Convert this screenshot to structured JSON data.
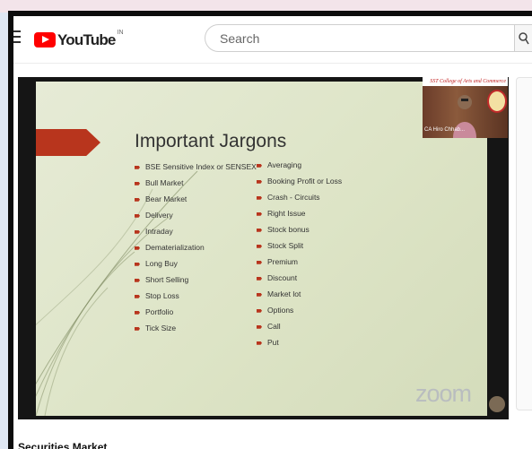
{
  "header": {
    "logo_text": "YouTube",
    "region": "IN",
    "search_placeholder": "Search",
    "search_icon": "search-icon",
    "menu_icon": "hamburger-menu-icon"
  },
  "slide": {
    "title": "Important Jargons",
    "left_items": [
      "BSE Sensitive Index or SENSEX",
      "Bull Market",
      "Bear Market",
      "Delivery",
      "Intraday",
      "Dematerialization",
      "Long Buy",
      "Short Selling",
      "Stop Loss",
      "Portfolio",
      "Tick Size"
    ],
    "right_items": [
      "Averaging",
      "Booking Profit or Loss",
      "Crash - Circuits",
      "Right Issue",
      "Stock bonus",
      "Stock Split",
      "Premium",
      "Discount",
      "Market lot",
      "Options",
      "Call",
      "Put"
    ]
  },
  "camera": {
    "banner": "SST College of Arts and Commerce",
    "name": "CA Hiro Chhab..."
  },
  "player": {
    "watermark": "zoom"
  },
  "video_title": "Securities Market",
  "colors": {
    "youtube_red": "#ff0000",
    "bullet_accent": "#b8351d",
    "slide_bg": "#dfe6c9"
  }
}
